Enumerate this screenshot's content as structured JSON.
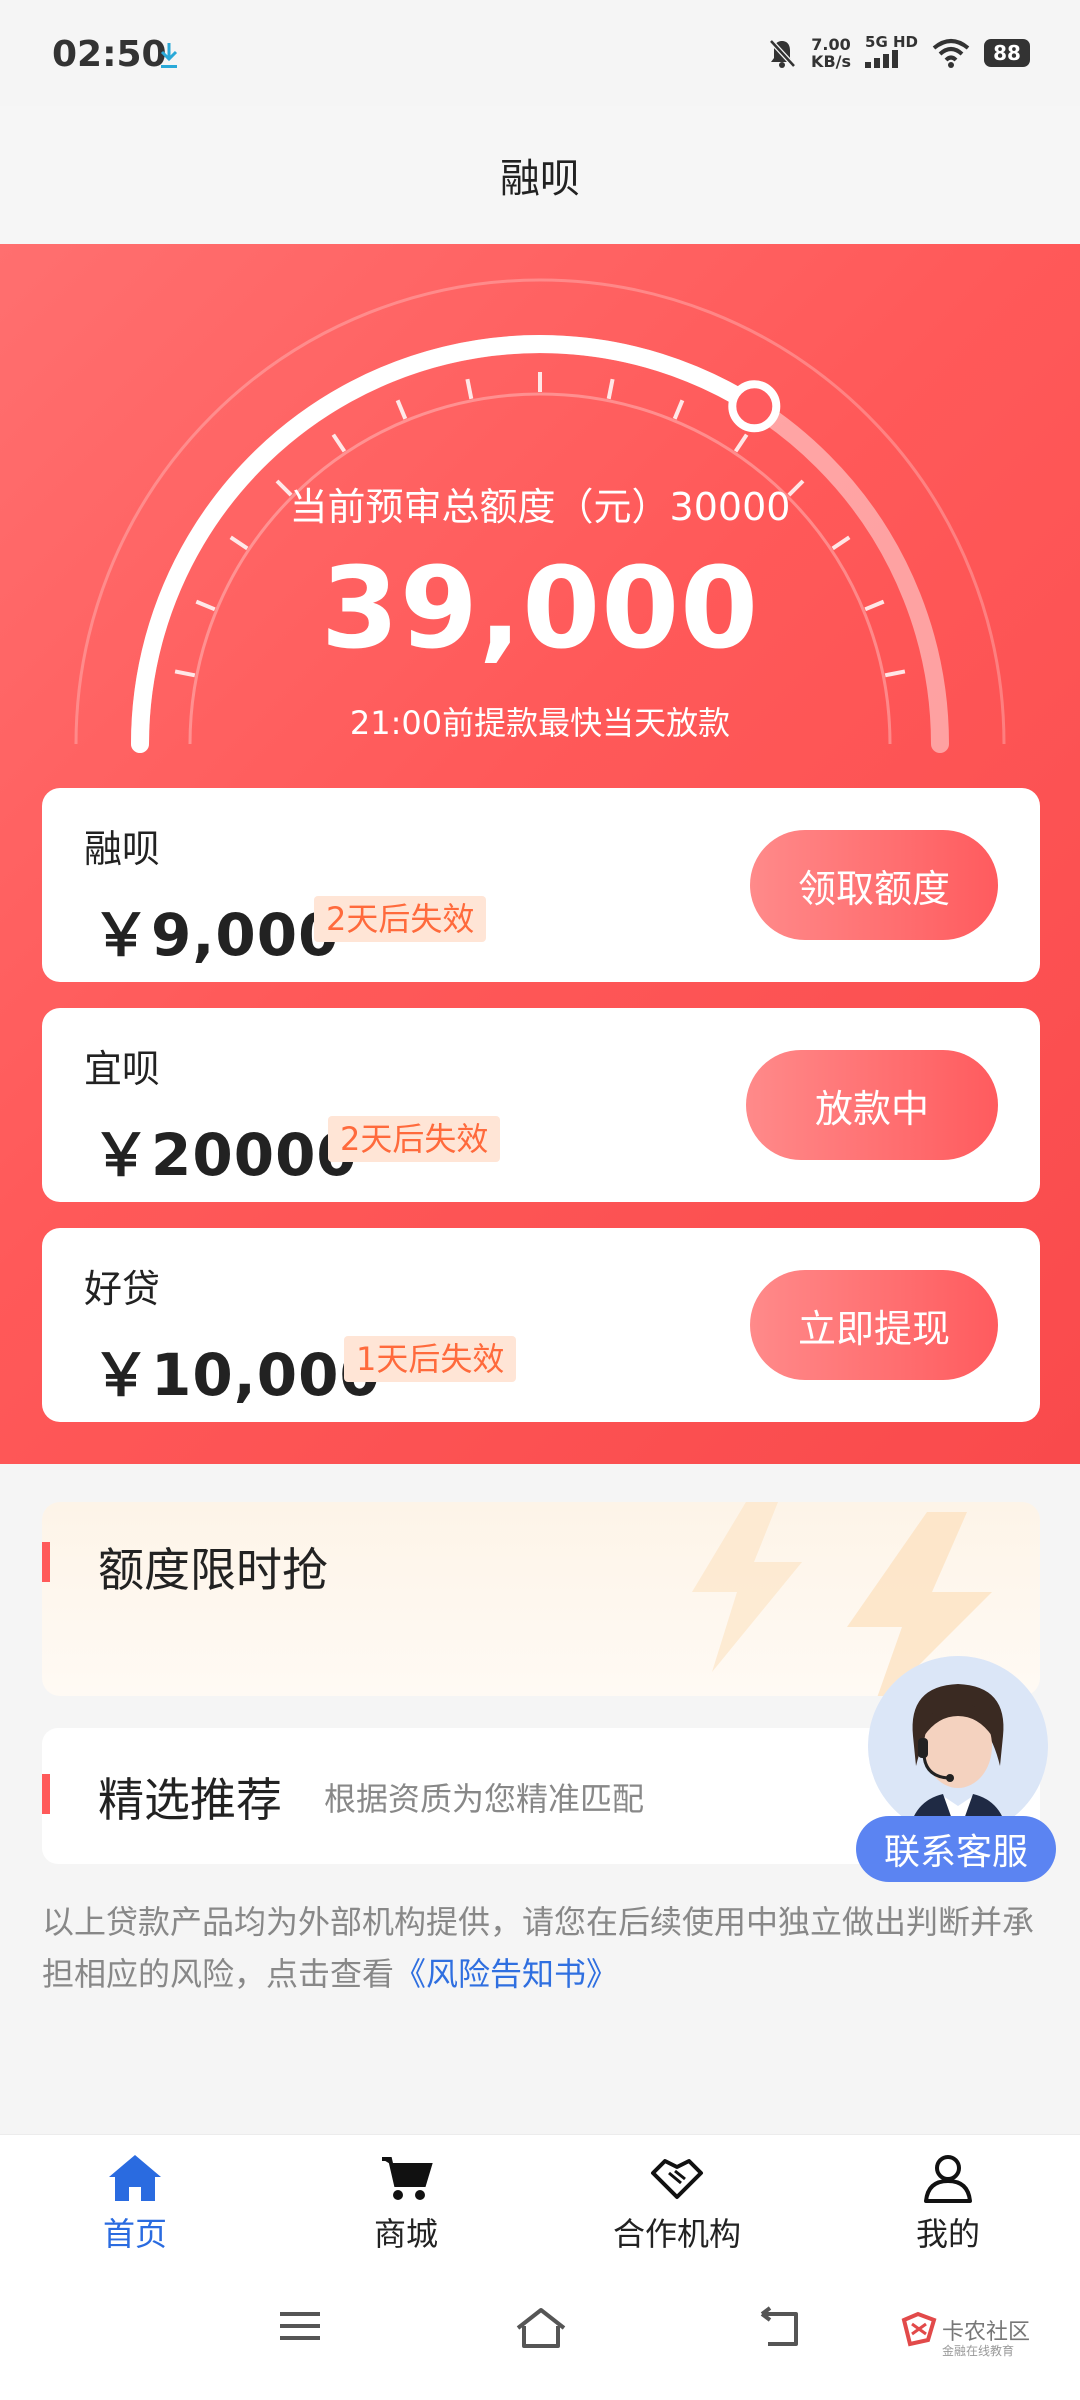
{
  "status_bar": {
    "time": "02:50",
    "speed_value": "7.00",
    "speed_unit": "KB/s",
    "network_top": "5G HD",
    "battery": "88",
    "icons": [
      "download-icon",
      "mute-icon",
      "signal-icon",
      "wifi-icon",
      "battery-icon"
    ]
  },
  "nav": {
    "title": "融呗"
  },
  "hero": {
    "label": "当前预审总额度（元）30000",
    "amount": "39,000",
    "note": "21:00前提款最快当天放款",
    "gauge_level": 0.68
  },
  "cards": [
    {
      "name": "融呗",
      "amount": "￥9,000",
      "badge": "2天后失效",
      "button": "领取额度"
    },
    {
      "name": "宜呗",
      "amount": "￥20000",
      "badge": "2天后失效",
      "button": "放款中"
    },
    {
      "name": "好贷",
      "amount": "￥10,000",
      "badge": "1天后失效",
      "button": "立即提现"
    }
  ],
  "promo": {
    "title": "额度限时抢"
  },
  "recommend": {
    "title": "精选推荐",
    "subtitle": "根据资质为您精准匹配"
  },
  "disclaimer": {
    "text": "以上贷款产品均为外部机构提供，请您在后续使用中独立做出判断并承担相应的风险，点击查看",
    "link": "《风险告知书》"
  },
  "customer_service": {
    "label": "联系客服"
  },
  "tabs": [
    {
      "label": "首页",
      "icon": "home-icon",
      "active": true
    },
    {
      "label": "商城",
      "icon": "cart-icon",
      "active": false
    },
    {
      "label": "合作机构",
      "icon": "handshake-icon",
      "active": false
    },
    {
      "label": "我的",
      "icon": "user-icon",
      "active": false
    }
  ],
  "watermark": {
    "title": "卡农社区",
    "subtitle": "金融在线教育"
  },
  "colors": {
    "hero_red": "#ff5959",
    "badge_text": "#ff6a3c",
    "badge_bg": "#ffe5d6",
    "active_tab": "#2a6be0",
    "link": "#2f6fe0",
    "service": "#5b84f2"
  }
}
